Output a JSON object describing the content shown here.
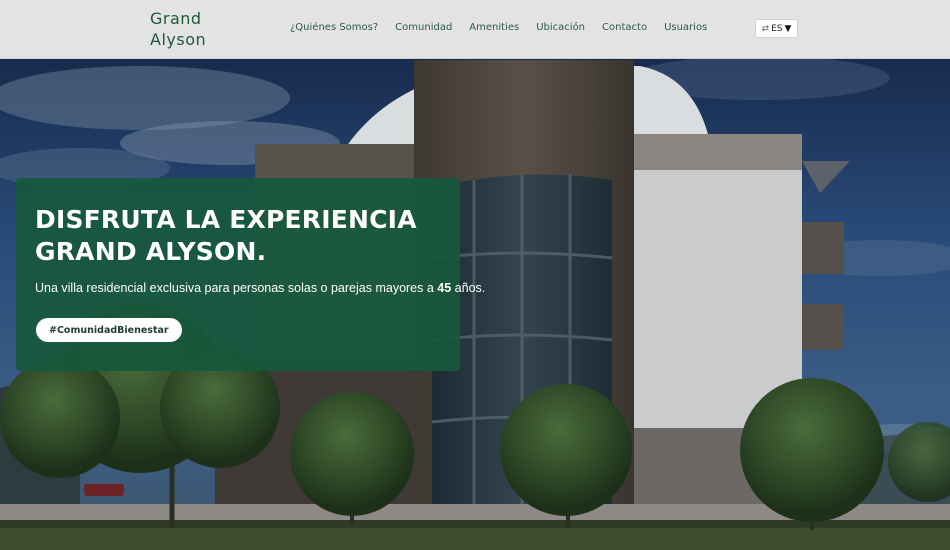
{
  "brand": {
    "line1": "Grand",
    "line2": "Alyson"
  },
  "nav": {
    "items": [
      {
        "label": "¿Quiénes Somos?"
      },
      {
        "label": "Comunidad"
      },
      {
        "label": "Amenities"
      },
      {
        "label": "Ubicación"
      },
      {
        "label": "Contacto"
      },
      {
        "label": "Usuarios"
      }
    ]
  },
  "language": {
    "icon": "language-swap-icon",
    "label": "ES",
    "caret_icon": "caret-down-icon"
  },
  "hero": {
    "heading_line1": "DISFRUTA LA EXPERIENCIA",
    "heading_line2": "GRAND ALYSON.",
    "desc_before": "Una villa residencial exclusiva para personas solas o parejas mayores a ",
    "desc_bold": "45",
    "desc_after": " años.",
    "hashtag": "#ComunidadBienestar"
  },
  "colors": {
    "brand_green": "#1e5a3a",
    "panel_green": "#18583c",
    "nav_bg": "#e3e3e3"
  }
}
